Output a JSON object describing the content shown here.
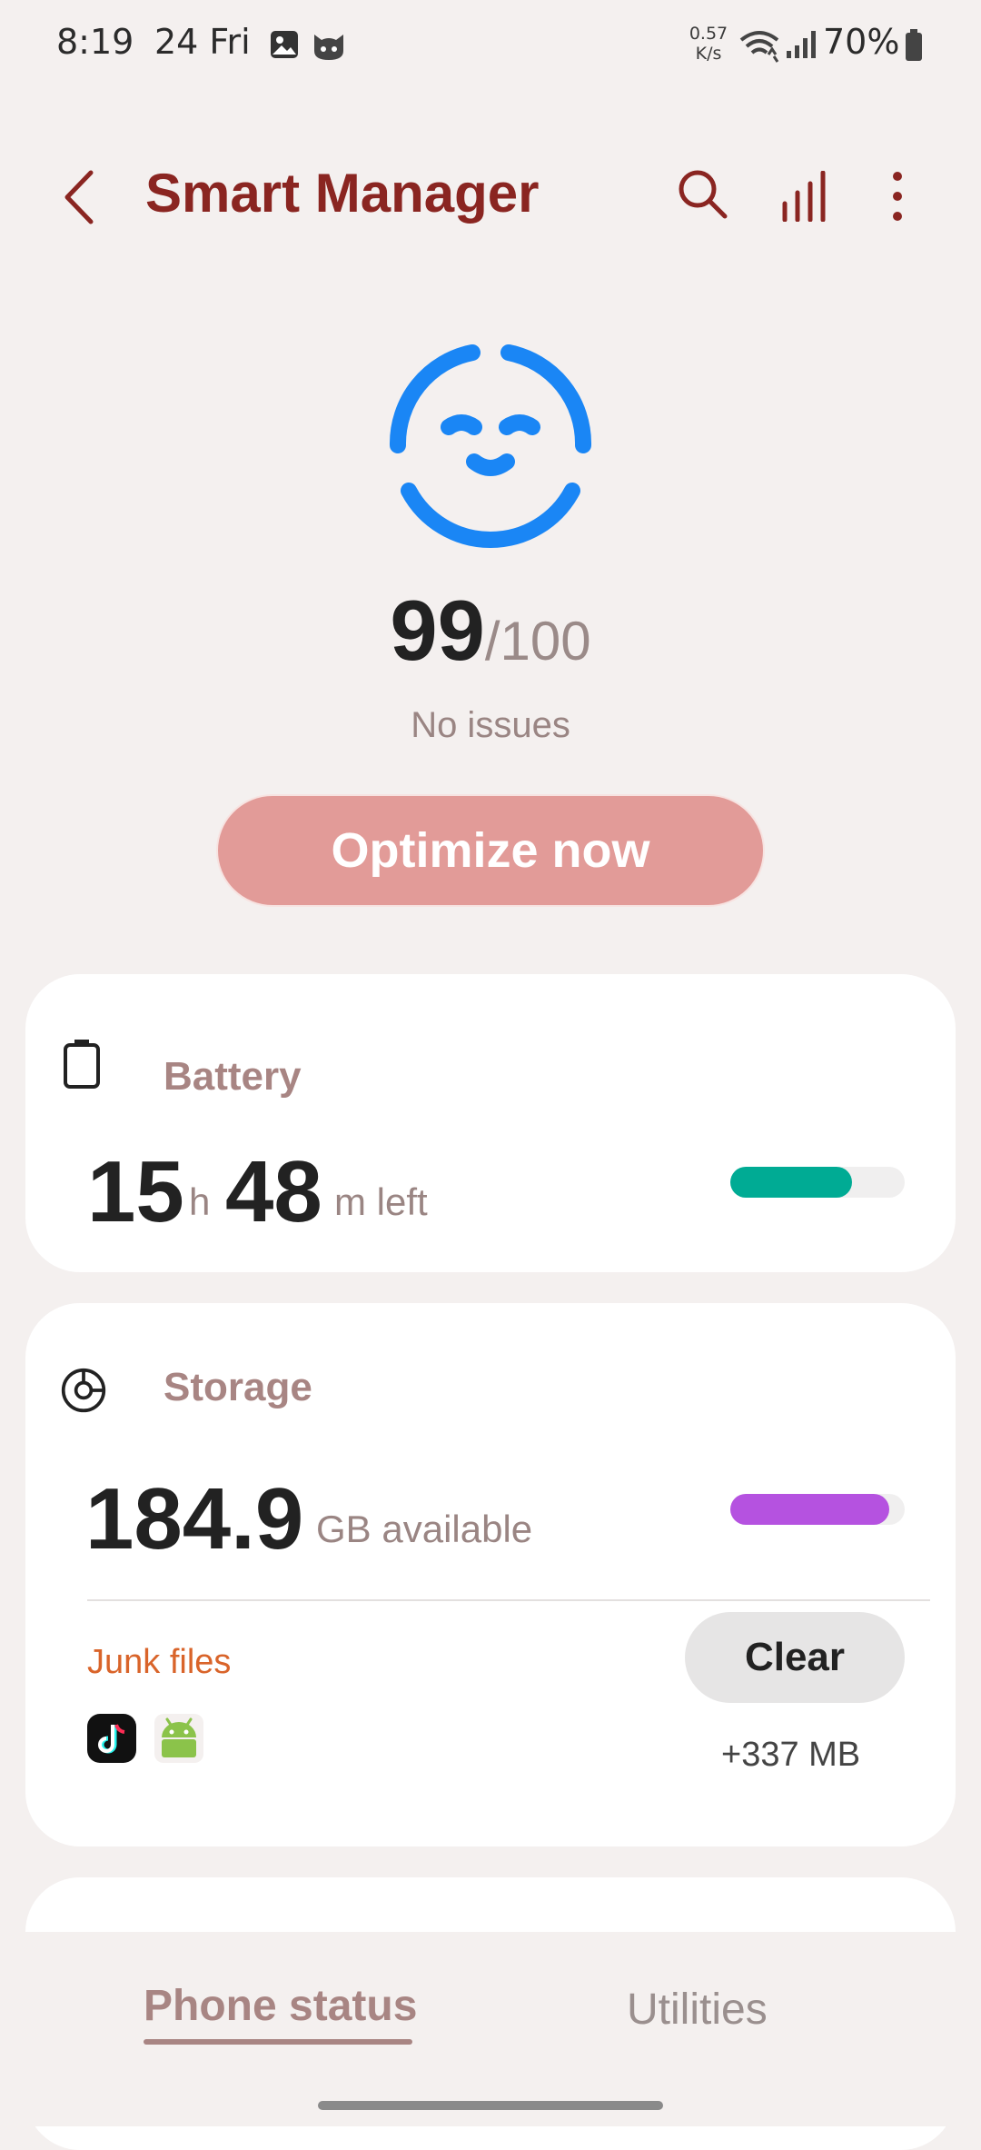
{
  "status_bar": {
    "time": "8:19",
    "date": "24 Fri",
    "net_speed_value": "0.57",
    "net_speed_unit": "K/s",
    "battery_percent": "70%"
  },
  "header": {
    "title": "Smart Manager"
  },
  "score": {
    "value": "99",
    "total": "/100",
    "status": "No issues",
    "face_color": "#1a86f5"
  },
  "optimize_button_label": "Optimize now",
  "battery_card": {
    "title": "Battery",
    "hours": "15",
    "hours_unit": "h",
    "minutes": "48",
    "minutes_unit": "m left",
    "level_fraction": 0.7,
    "bar_color": "#00ab94"
  },
  "storage_card": {
    "title": "Storage",
    "available_value": "184.9",
    "available_unit": "GB available",
    "used_fraction": 0.91,
    "bar_color": "#b552e0",
    "junk_label": "Junk files",
    "clear_label": "Clear",
    "junk_size": "+337 MB",
    "junk_apps": [
      "tiktok-icon",
      "android-icon"
    ]
  },
  "bottom_nav": {
    "tabs": [
      {
        "label": "Phone status",
        "active": true
      },
      {
        "label": "Utilities",
        "active": false
      }
    ]
  },
  "colors": {
    "accent": "#8a2521",
    "optimize": "#e29b98",
    "junk": "#d9642a"
  }
}
